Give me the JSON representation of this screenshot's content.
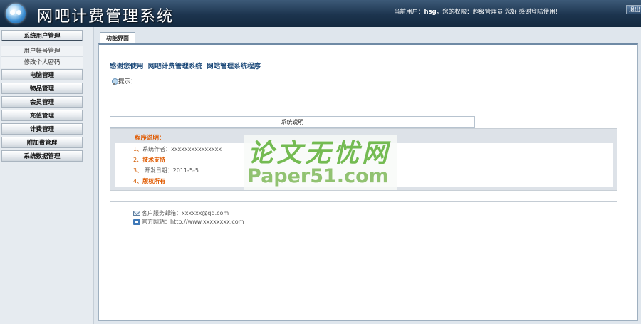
{
  "header": {
    "title": "网吧计费管理系统",
    "user_prefix": "当前用户：",
    "user_name": "hsg",
    "user_mid": "，您的权限：",
    "role": "超级管理员",
    "user_suffix": " 您好,感谢登陆使用!",
    "logout_label": "退出"
  },
  "sidebar": {
    "groups": [
      {
        "label": "系统用户管理",
        "items": [
          "用户帐号管理",
          "修改个人密码"
        ]
      },
      {
        "label": "电脑管理"
      },
      {
        "label": "物品管理"
      },
      {
        "label": "会员管理"
      },
      {
        "label": "充值管理"
      },
      {
        "label": "计费管理"
      },
      {
        "label": "附加费管理"
      },
      {
        "label": "系统数据管理"
      }
    ]
  },
  "main": {
    "tab_label": "功能界面",
    "welcome": "感谢您使用 网吧计费管理系统 网站管理系统程序",
    "hint": "提示：",
    "sys_header": "系统说明",
    "prog_title": "程序说明：",
    "info": [
      {
        "num": "1、",
        "text": "系统作者：xxxxxxxxxxxxxxx"
      },
      {
        "num": "2、",
        "text": "技术支持"
      },
      {
        "num": "3、",
        "text": "  开发日期：2011-5-5"
      },
      {
        "num": "4、",
        "text": "版权所有"
      }
    ],
    "contact": {
      "email_label": "客户服务邮箱：",
      "email_value": "xxxxxx@qq.com",
      "site_label": "官方网站：",
      "site_value": "http://www.xxxxxxxx.com"
    }
  },
  "watermark": {
    "cn": "论文无忧网",
    "en": "Paper51.com"
  }
}
